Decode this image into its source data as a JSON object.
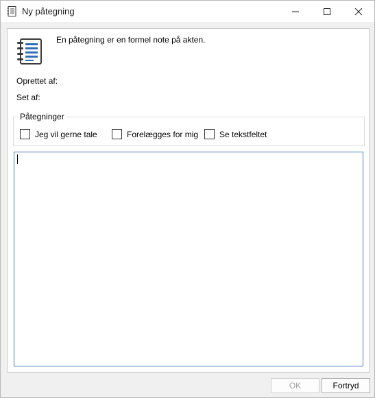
{
  "window": {
    "title": "Ny påtegning",
    "controls": {
      "minimize": "minimize-icon",
      "maximize": "maximize-icon",
      "close": "close-icon"
    }
  },
  "info": {
    "text": "En påtegning er en formel note på akten."
  },
  "fields": {
    "created_label": "Oprettet af:",
    "created_value": "",
    "seen_label": "Set af:",
    "seen_value": ""
  },
  "annotations": {
    "legend": "Påtegninger",
    "options": [
      {
        "label": "Jeg vil gerne tale",
        "checked": false
      },
      {
        "label": "Forelægges for mig",
        "checked": false
      },
      {
        "label": "Se tekstfeltet",
        "checked": false
      }
    ]
  },
  "note_text": "",
  "buttons": {
    "ok": "OK",
    "cancel": "Fortryd",
    "ok_enabled": false
  },
  "colors": {
    "textarea_border": "#4a7ab5",
    "icon_accent": "#2e6fb5"
  }
}
